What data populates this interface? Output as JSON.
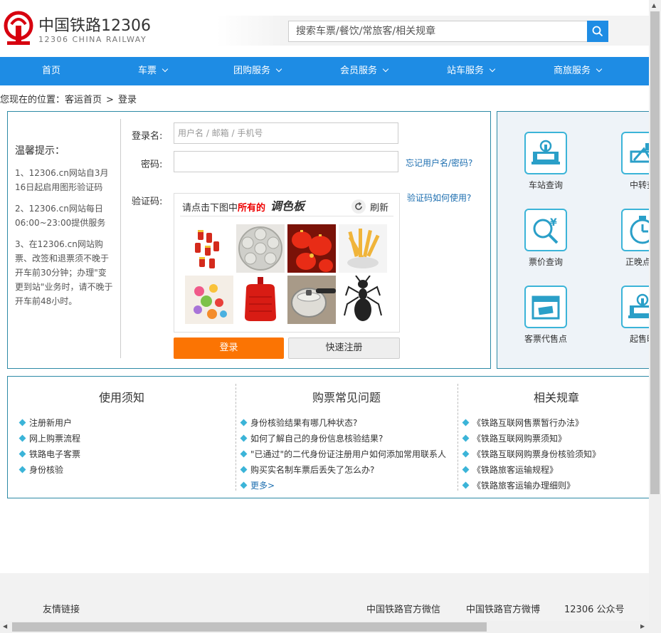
{
  "header": {
    "logo_cn": "中国铁路12306",
    "logo_en": "12306 CHINA RAILWAY",
    "search_placeholder": "搜索车票/餐饮/常旅客/相关规章"
  },
  "nav": [
    {
      "label": "首页",
      "dropdown": false
    },
    {
      "label": "车票",
      "dropdown": true
    },
    {
      "label": "团购服务",
      "dropdown": true
    },
    {
      "label": "会员服务",
      "dropdown": true
    },
    {
      "label": "站车服务",
      "dropdown": true
    },
    {
      "label": "商旅服务",
      "dropdown": true
    }
  ],
  "breadcrumb": {
    "prefix": "您现在的位置：",
    "home": "客运首页",
    "sep": ">",
    "current": "登录"
  },
  "tips": {
    "title": "温馨提示：",
    "items": [
      "1、12306.cn网站自3月16日起启用图形验证码",
      "2、12306.cn网站每日06:00~23:00提供服务",
      "3、在12306.cn网站购票、改签和退票须不晚于开车前30分钟；办理\"变更到站\"业务时，请不晚于开车前48小时。"
    ]
  },
  "login": {
    "username_label": "登录名:",
    "username_placeholder": "用户名 / 邮箱 / 手机号",
    "password_label": "密码:",
    "forgot": "忘记用户名/密码?",
    "captcha_label": "验证码:",
    "captcha_help": "验证码如何使用?",
    "captcha_prompt_pre": "请点击下图中",
    "captcha_prompt_em": "所有的",
    "captcha_word": "调色板",
    "refresh": "刷新",
    "login_btn": "登录",
    "register_btn": "快速注册"
  },
  "captcha_images": [
    "firecrackers",
    "palette-plate",
    "lanterns",
    "fries",
    "candies",
    "hot-water-bottle",
    "pressure-cooker",
    "ant"
  ],
  "services": [
    {
      "label": "车站查询",
      "icon": "station-icon"
    },
    {
      "label": "中转查",
      "icon": "transfer-icon"
    },
    {
      "label": "票价查询",
      "icon": "fare-icon"
    },
    {
      "label": "正晚点查",
      "icon": "clock-icon"
    },
    {
      "label": "客票代售点",
      "icon": "ticket-agent-icon"
    },
    {
      "label": "起售时",
      "icon": "sale-time-icon"
    }
  ],
  "notice": {
    "col1": {
      "title": "使用须知",
      "items": [
        "注册新用户",
        "网上购票流程",
        "铁路电子客票",
        "身份核验"
      ]
    },
    "col2": {
      "title": "购票常见问题",
      "items": [
        "身份核验结果有哪几种状态?",
        "如何了解自己的身份信息核验结果?",
        "\"已通过\"的二代身份证注册用户如何添加常用联系人",
        "购买实名制车票后丢失了怎么办?"
      ],
      "more": "更多>"
    },
    "col3": {
      "title": "相关规章",
      "items": [
        "《铁路互联网售票暂行办法》",
        "《铁路互联网购票须知》",
        "《铁路互联网购票身份核验须知》",
        "《铁路旅客运输规程》",
        "《铁路旅客运输办理细则》"
      ]
    }
  },
  "footer": {
    "friends": "友情链接",
    "links": [
      "中国铁路官方微信",
      "中国铁路官方微博",
      "12306 公众号"
    ]
  },
  "colors": {
    "brand_blue": "#1e8ce4",
    "accent_orange": "#fb7403",
    "border_teal": "#2d8aa6",
    "icon_cyan": "#3bb4d8",
    "logo_red": "#d7000f"
  }
}
